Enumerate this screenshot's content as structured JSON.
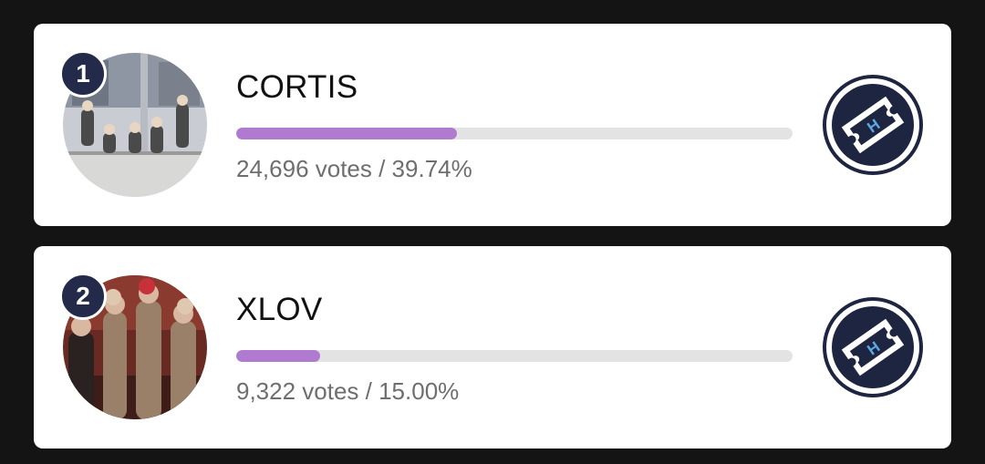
{
  "candidates": [
    {
      "rank": "1",
      "name": "CORTIS",
      "votes_text": "24,696 votes / 39.74%",
      "percent": 39.74,
      "photo_icon": "group-photo-icon",
      "vote_icon": "ticket-h-icon"
    },
    {
      "rank": "2",
      "name": "XLOV",
      "votes_text": "9,322 votes / 15.00%",
      "percent": 15.0,
      "photo_icon": "group-photo-icon",
      "vote_icon": "ticket-h-icon"
    }
  ],
  "colors": {
    "background": "#141414",
    "card": "#ffffff",
    "bar_fill": "#b07ad0",
    "bar_track": "#e3e3e3",
    "rank_badge": "#232a4a",
    "ticket_ring": "#1e2540",
    "ticket_letter": "#5aa8e6"
  }
}
